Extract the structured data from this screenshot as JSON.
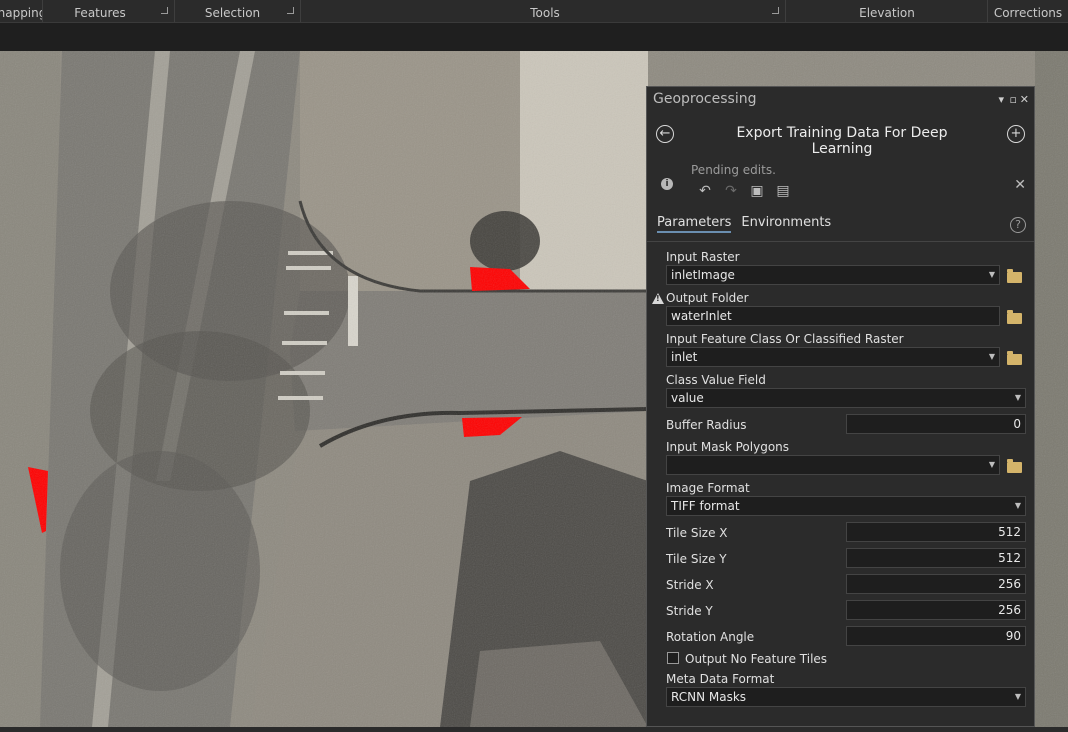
{
  "ribbon": {
    "groups": [
      "Snapping",
      "Features",
      "Selection",
      "Tools",
      "Elevation",
      "Corrections"
    ]
  },
  "panel": {
    "title": "Geoprocessing",
    "tool_title": "Export Training Data For Deep Learning",
    "pending_text": "Pending edits.",
    "tabs": {
      "parameters": "Parameters",
      "environments": "Environments"
    },
    "params": {
      "input_raster": {
        "label": "Input Raster",
        "value": "inletImage"
      },
      "output_folder": {
        "label": "Output Folder",
        "value": "waterInlet"
      },
      "input_feature_class": {
        "label": "Input Feature Class Or Classified Raster",
        "value": "inlet"
      },
      "class_value_field": {
        "label": "Class Value Field",
        "value": "value"
      },
      "buffer_radius": {
        "label": "Buffer Radius",
        "value": "0"
      },
      "input_mask_polygons": {
        "label": "Input Mask Polygons",
        "value": ""
      },
      "image_format": {
        "label": "Image Format",
        "value": "TIFF format"
      },
      "tile_size_x": {
        "label": "Tile Size X",
        "value": "512"
      },
      "tile_size_y": {
        "label": "Tile Size Y",
        "value": "512"
      },
      "stride_x": {
        "label": "Stride X",
        "value": "256"
      },
      "stride_y": {
        "label": "Stride Y",
        "value": "256"
      },
      "rotation_angle": {
        "label": "Rotation Angle",
        "value": "90"
      },
      "output_no_feature_tiles": {
        "label": "Output No Feature Tiles",
        "checked": false
      },
      "meta_data_format": {
        "label": "Meta Data Format",
        "value": "RCNN Masks"
      }
    }
  },
  "colors": {
    "panel_bg": "#2b2b2b",
    "field_bg": "#1e1e1e",
    "label_red": "#ff0000",
    "accent": "#6a8eb0"
  }
}
